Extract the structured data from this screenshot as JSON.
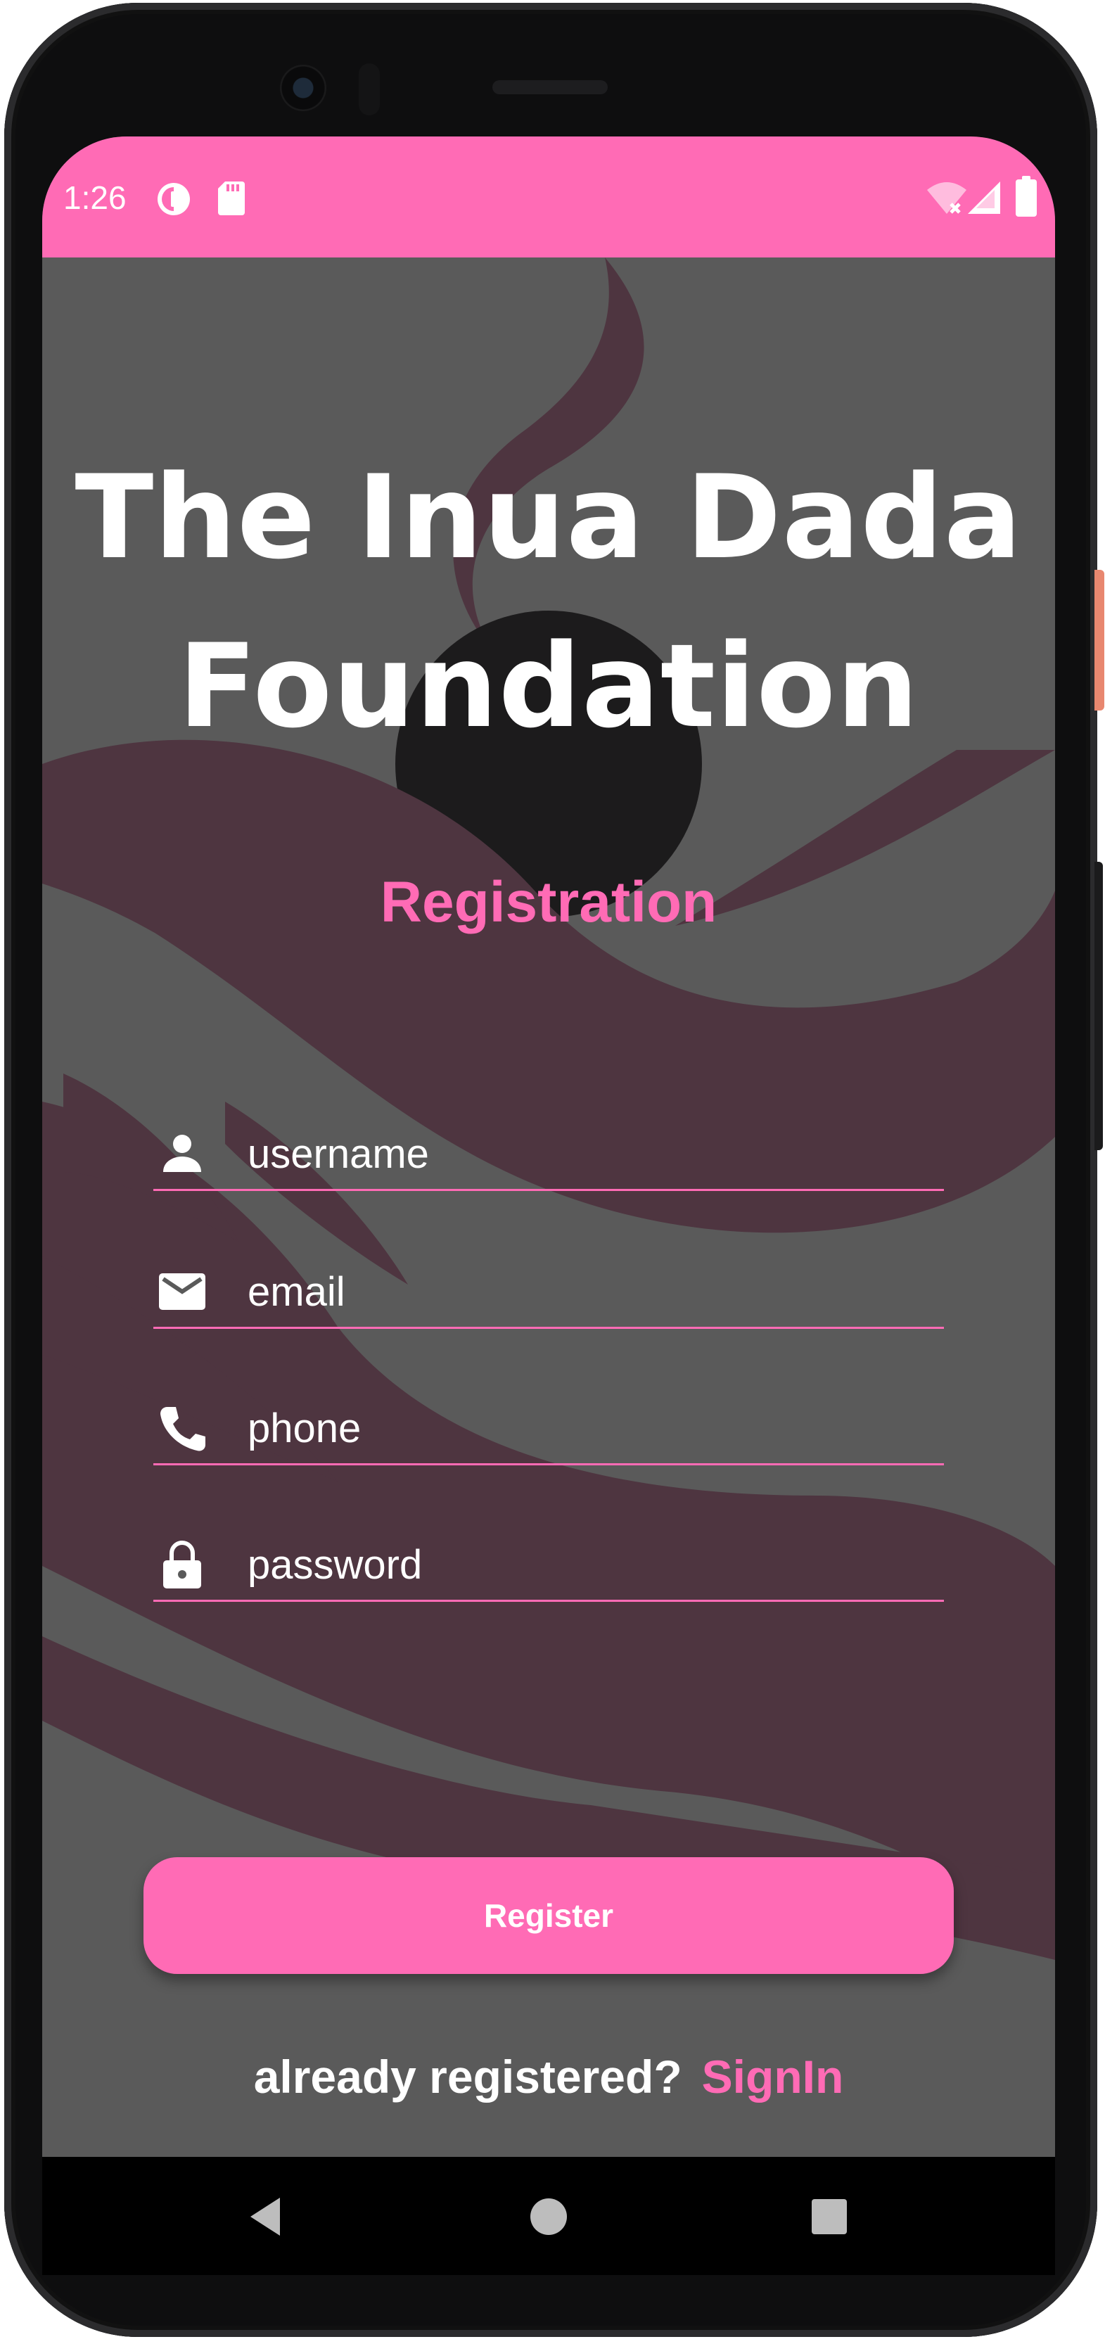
{
  "status_bar": {
    "time": "1:26",
    "color": "#ff6bb5",
    "left_icons": [
      "sync-icon",
      "sd-card-icon"
    ],
    "right_icons": [
      "wifi-off-icon",
      "cell-signal-icon",
      "battery-icon"
    ]
  },
  "app": {
    "title_line1": "The Inua Dada",
    "title_line2": "Foundation",
    "heading": "Registration",
    "accent_color": "#ff6bb5",
    "fields": {
      "username": {
        "placeholder": "username",
        "icon": "person-icon"
      },
      "email": {
        "placeholder": "email",
        "icon": "mail-icon"
      },
      "phone": {
        "placeholder": "phone",
        "icon": "phone-icon"
      },
      "password": {
        "placeholder": "password",
        "icon": "lock-icon"
      }
    },
    "register_label": "Register",
    "already_registered": "already registered?",
    "signin_label": "SignIn"
  },
  "nav_bar": {
    "buttons": [
      "back-icon",
      "home-icon",
      "recents-icon"
    ]
  }
}
